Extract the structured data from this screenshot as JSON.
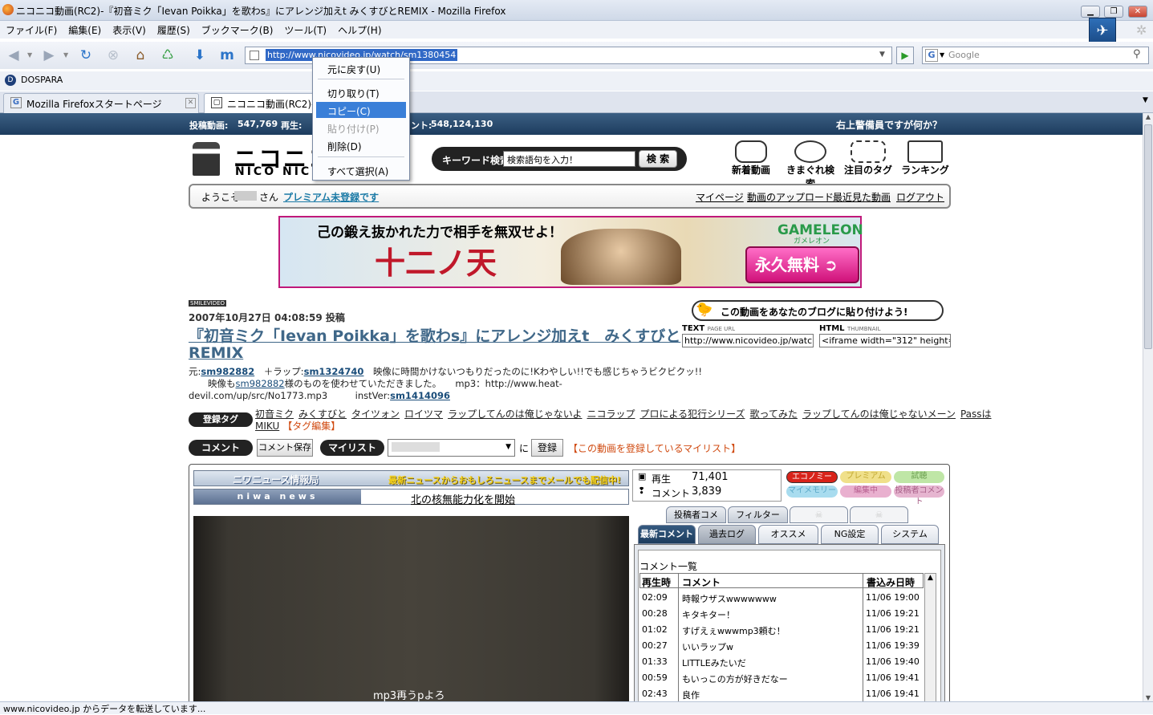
{
  "window": {
    "title": "ニコニコ動画(RC2)-『初音ミク「Ievan Poikka」を歌わs』にアレンジ加えt みくすびとREMIX - Mozilla Firefox"
  },
  "menu": [
    "ファイル(F)",
    "編集(E)",
    "表示(V)",
    "履歴(S)",
    "ブックマーク(B)",
    "ツール(T)",
    "ヘルプ(H)"
  ],
  "nav": {
    "url": "http://www.nicovideo.jp/watch/sm1380454",
    "search_placeholder": "Google"
  },
  "bookmarks": {
    "item": "DOSPARA"
  },
  "tabs": [
    "Mozilla Firefoxスタートページ",
    "ニコニコ動画(RC2)-"
  ],
  "context_menu": {
    "items": [
      "元に戻す(U)",
      "切り取り(T)",
      "コピー(C)",
      "貼り付け(P)",
      "削除(D)",
      "すべて選択(A)"
    ],
    "highlighted": "コピー(C)"
  },
  "stats": {
    "posted_label": "投稿動画:",
    "posted": "547,769",
    "play_label": "再生:",
    "comment_label": "ント:",
    "comments": "548,124,130",
    "catch": "右上警備員ですが何か？"
  },
  "site": {
    "logo_jp": "ニコニコ動",
    "logo_en": "NICO NIC",
    "search_label": "キーワード検索",
    "search_placeholder": "検索語句を入力！",
    "search_btn": "検 索",
    "icons": [
      "新着動画",
      "きまぐれ検索",
      "注目のタグ",
      "ランキング"
    ]
  },
  "userbar": {
    "welcome": "ようこそ",
    "san": "さん",
    "premium": "プレミアム未登録です",
    "links": [
      "マイページ",
      "動画のアップロード",
      "最近見た動画",
      "ログアウト"
    ]
  },
  "ad": {
    "headline": "己の鍛え抜かれた力で相手を無双せよ！",
    "title": "十二ノ天",
    "brand": "GAMELEON",
    "brand_kana": "ガメレオン",
    "cta": "永久無料"
  },
  "video": {
    "smile": "SMILEVIDEO",
    "posted": "2007年10月27日 04:08:59 投稿",
    "title1": "『初音ミク「Ievan Poikka」を歌わs』にアレンジ加えt　みくすびと",
    "title2": "REMIX",
    "desc_orig_label": "元:",
    "desc_orig": "sm982882",
    "desc_rap_label": "＋ラップ:",
    "desc_rap": "sm1324740",
    "desc_text1": "映像に時間かけないつもりだったのに!Kわやしい!!でも感じちゃうビクビクッ!!",
    "desc_line2_pre": "映像も",
    "desc_line2_link": "sm982882",
    "desc_line2_post": "様のものを使わせていただきました。　　mp3：http://www.heat-",
    "desc_line3": "devil.com/up/src/No1773.mp3",
    "instver_label": "instVer:",
    "instver": "sm1414096"
  },
  "tags": {
    "label": "登録タグ",
    "list": [
      "初音ミク",
      "みくすびと",
      "タイツォン",
      "ロイツマ",
      "ラップしてんのは俺じゃないよ",
      "ニコラップ",
      "プロによる犯行シリーズ",
      "歌ってみた",
      "ラップしてんのは俺じゃないメーン",
      "Passは"
    ],
    "line2_tag": "MIKU",
    "edit": "【タグ編集】"
  },
  "actions": {
    "comment": "コメント",
    "comment_save": "コメント保存",
    "mylist": "マイリスト",
    "mylist_value": "",
    "ni": "に",
    "register": "登録",
    "mylist_link": "【この動画を登録しているマイリスト】"
  },
  "blog": {
    "banner": "この動画をあなたのブログに貼り付けよう!",
    "text_label": "TEXT",
    "text_sub": "PAGE URL",
    "text_value": "http://www.nicovideo.jp/watch/",
    "html_label": "HTML",
    "html_sub": "THUMBNAIL",
    "html_value": "<iframe width=\"312\" height=\"1"
  },
  "player": {
    "news_title": "ニワニュース情報局",
    "news_sub": "最新ニュースからおもしろニュースまでメールでも配信中!",
    "niwa": "niwa news",
    "headline": "北の核無能力化を開始",
    "subtitle": "mp3再うpよろ"
  },
  "counts": {
    "play_label": "再生",
    "play": "71,401",
    "comment_label": "コメント",
    "comment": "3,839"
  },
  "badges": [
    "エコノミー",
    "プレミアム",
    "試聴",
    "マイメモリー",
    "編集中",
    "投稿者コメント"
  ],
  "panel_tabs_top": [
    "投稿者コメ",
    "フィルター",
    "",
    ""
  ],
  "panel_tabs": [
    "最新コメント",
    "過去ログ",
    "オススメ",
    "NG設定",
    "システム"
  ],
  "comments": {
    "title": "コメント一覧",
    "headers": [
      "再生時",
      "コメント",
      "書込み日時"
    ],
    "rows": [
      [
        "02:09",
        "時報ウザスwwwwwww",
        "11/06 19:00"
      ],
      [
        "00:28",
        "キタキター！",
        "11/06 19:21"
      ],
      [
        "01:02",
        "すげえぇwwwmp3頼む！",
        "11/06 19:21"
      ],
      [
        "00:27",
        "いいラップw",
        "11/06 19:39"
      ],
      [
        "01:33",
        "LITTLEみたいだ",
        "11/06 19:40"
      ],
      [
        "00:59",
        "もいっこの方が好きだなー",
        "11/06 19:41"
      ],
      [
        "02:43",
        "良作",
        "11/06 19:41"
      ]
    ]
  },
  "status": "www.nicovideo.jp からデータを転送しています...",
  "colors": {
    "accent": "#1d3c5e",
    "link": "#1a4d7a",
    "highlight": "#3a7fd8",
    "ad_border": "#c0187a"
  }
}
